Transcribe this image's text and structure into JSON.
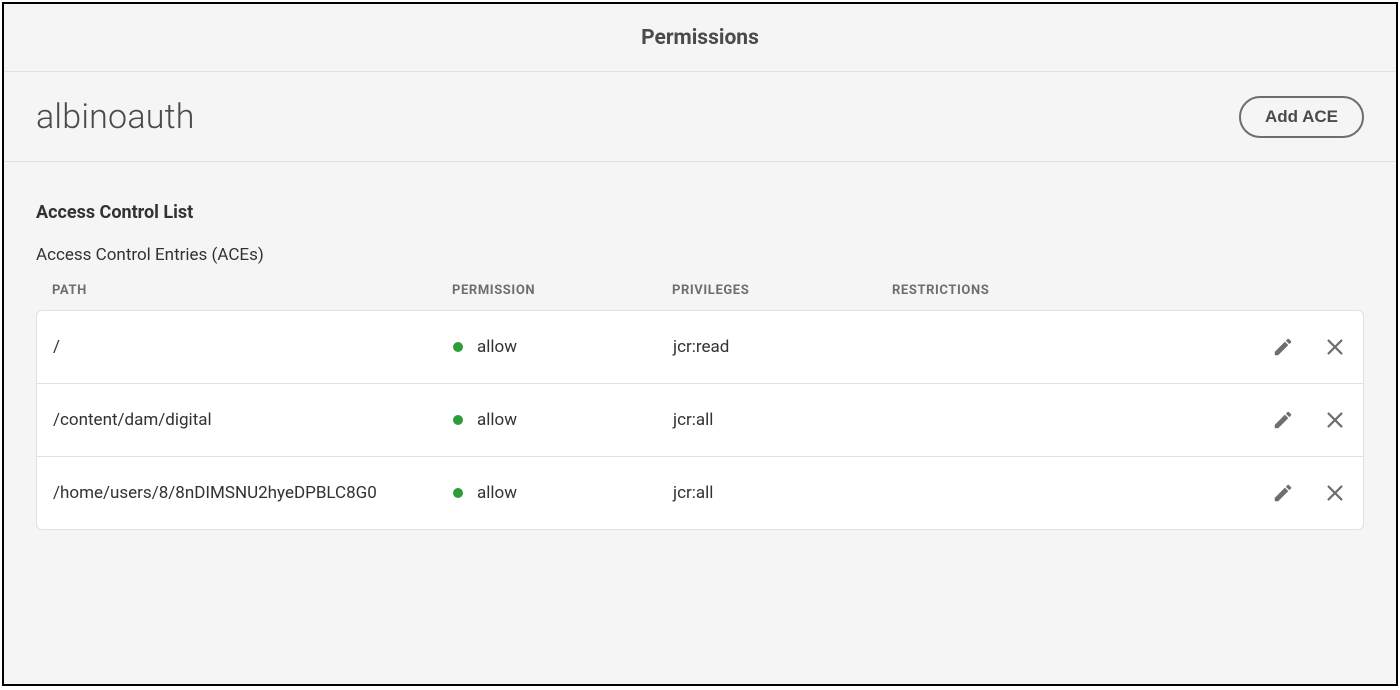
{
  "header": {
    "title": "Permissions"
  },
  "user": {
    "name": "albinoauth",
    "add_ace_label": "Add ACE"
  },
  "acl": {
    "heading": "Access Control List",
    "subheading": "Access Control Entries (ACEs)",
    "columns": {
      "path": "PATH",
      "permission": "PERMISSION",
      "privileges": "PRIVILEGES",
      "restrictions": "RESTRICTIONS"
    },
    "entries": [
      {
        "path": "/",
        "permission": "allow",
        "status_color": "#2d9d3a",
        "privileges": "jcr:read",
        "restrictions": ""
      },
      {
        "path": "/content/dam/digital",
        "permission": "allow",
        "status_color": "#2d9d3a",
        "privileges": "jcr:all",
        "restrictions": ""
      },
      {
        "path": "/home/users/8/8nDIMSNU2hyeDPBLC8G0",
        "permission": "allow",
        "status_color": "#2d9d3a",
        "privileges": "jcr:all",
        "restrictions": ""
      }
    ]
  }
}
